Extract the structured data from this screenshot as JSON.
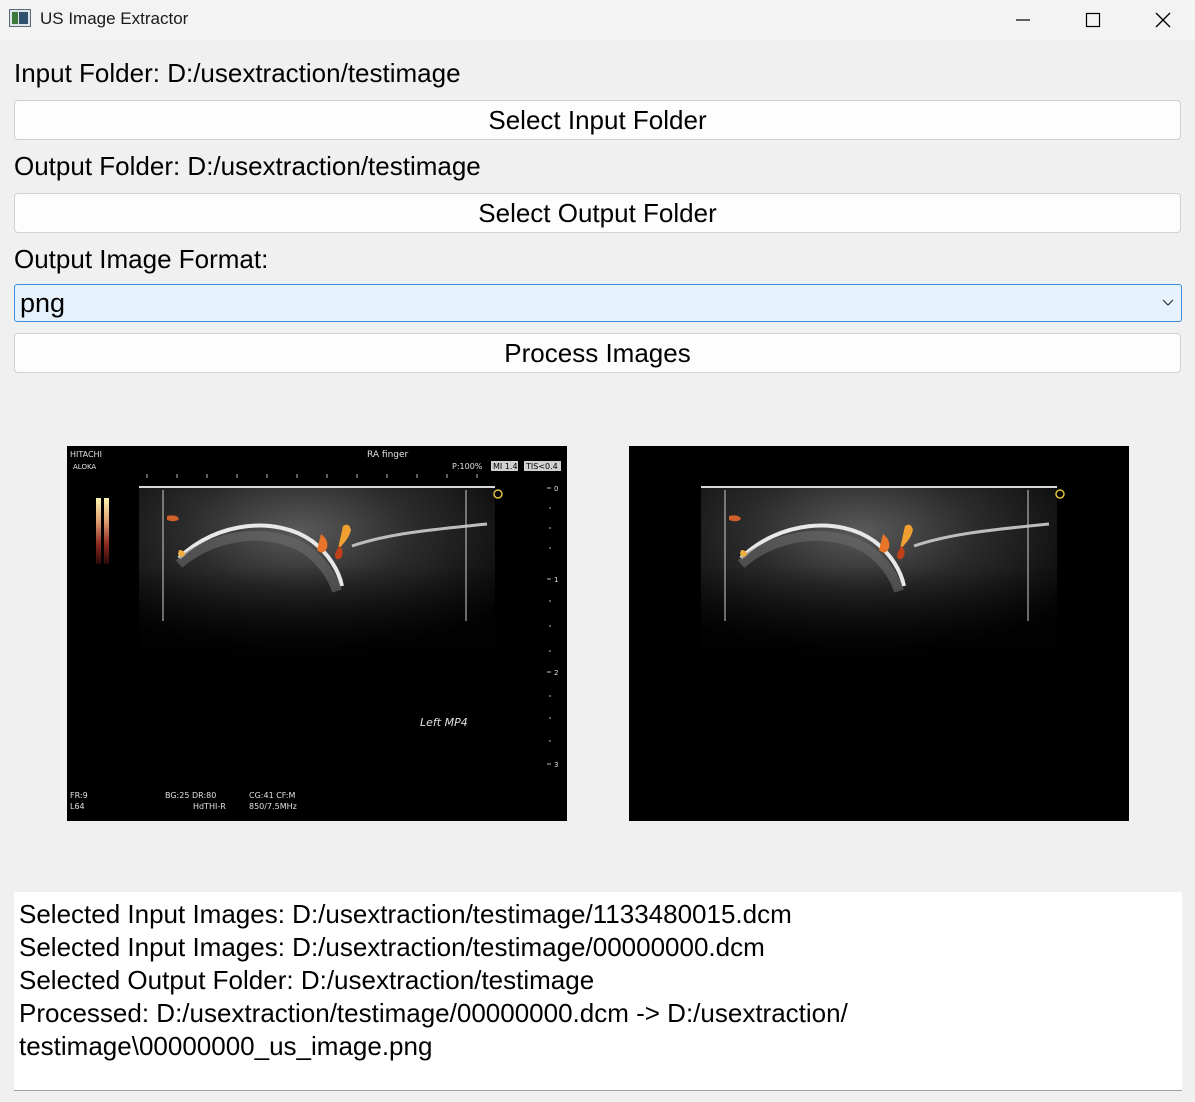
{
  "window": {
    "title": "US Image Extractor",
    "controls": [
      "minimize",
      "maximize",
      "close"
    ]
  },
  "input": {
    "label": "Input Folder: D:/usextraction/testimage",
    "button_label": "Select Input Folder"
  },
  "output": {
    "label": "Output Folder: D:/usextraction/testimage",
    "button_label": "Select Output Folder"
  },
  "format": {
    "label": "Output Image Format:",
    "selected": "png"
  },
  "process": {
    "button_label": "Process Images"
  },
  "preview": {
    "original": {
      "brand_line1": "HITACHI",
      "brand_line2": "ALOKA",
      "study": "RA finger",
      "power": "P:100%",
      "mi": "MI 1.4",
      "tis": "TIS<0.4",
      "depth_ticks": [
        "0",
        "1",
        "2",
        "3"
      ],
      "annotation": "Left MP4",
      "footer_left_1": "FR:9",
      "footer_left_2": "L64",
      "footer_mid_1": "BG:25   DR:80",
      "footer_mid_2": "HdTHI-R",
      "footer_right_1": "CG:41   CF:M",
      "footer_right_2": "850/7.5MHz"
    }
  },
  "log": {
    "lines": [
      "Selected Input Images: D:/usextraction/testimage/1133480015.dcm",
      "Selected Input Images: D:/usextraction/testimage/00000000.dcm",
      "Selected Output Folder: D:/usextraction/testimage",
      "Processed: D:/usextraction/testimage/00000000.dcm -> D:/usextraction/",
      "testimage\\00000000_us_image.png"
    ]
  },
  "colors": {
    "window_bg": "#f0f0f0",
    "combo_bg": "#e5f1fb",
    "combo_border": "#3c8ed6",
    "doppler_orange": "#e8742a"
  }
}
